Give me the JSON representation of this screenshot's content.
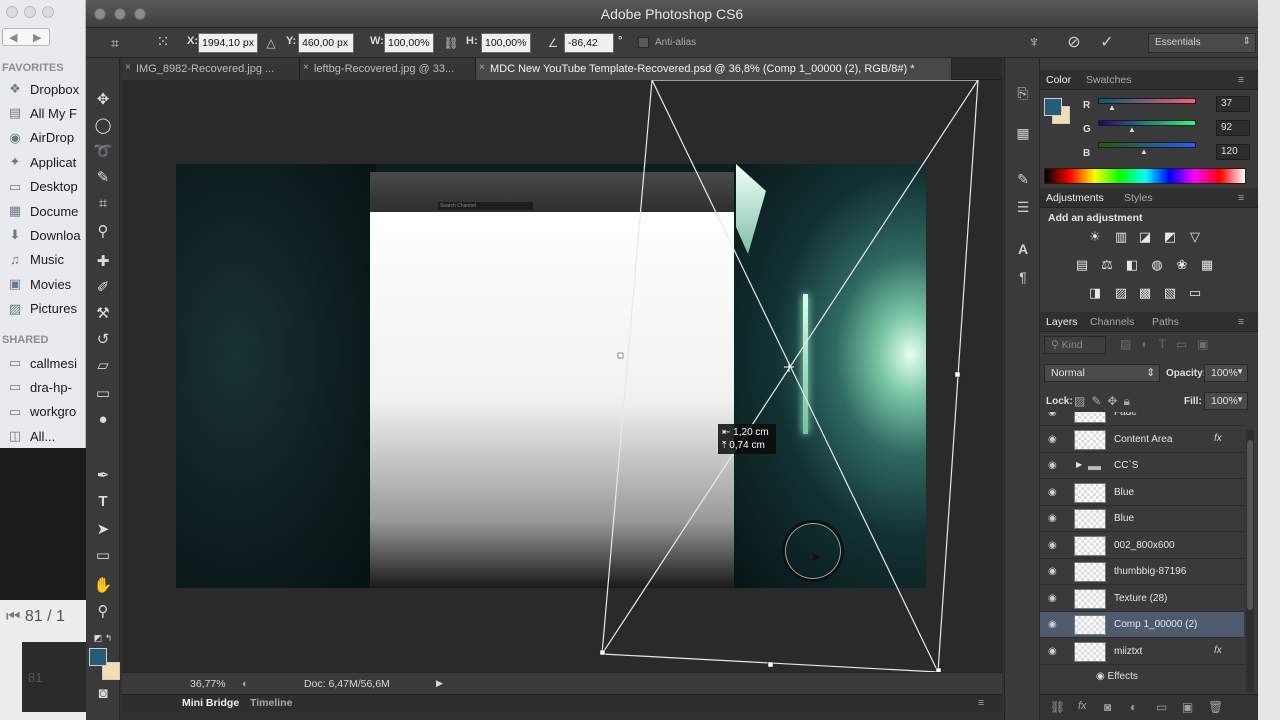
{
  "finder": {
    "favorites_header": "FAVORITES",
    "shared_header": "SHARED",
    "favorites": [
      {
        "icon": "dropbox-icon",
        "glyph": "❖",
        "label": "Dropbox"
      },
      {
        "icon": "all-my-files-icon",
        "glyph": "▤",
        "label": "All My F"
      },
      {
        "icon": "airdrop-icon",
        "glyph": "◉",
        "label": "AirDrop"
      },
      {
        "icon": "applications-icon",
        "glyph": "✦",
        "label": "Applicat"
      },
      {
        "icon": "desktop-icon",
        "glyph": "▭",
        "label": "Desktop"
      },
      {
        "icon": "documents-icon",
        "glyph": "▦",
        "label": "Docume"
      },
      {
        "icon": "downloads-icon",
        "glyph": "⬇",
        "label": "Downloa"
      },
      {
        "icon": "music-icon",
        "glyph": "♫",
        "label": "Music"
      },
      {
        "icon": "movies-icon",
        "glyph": "▣",
        "label": "Movies"
      },
      {
        "icon": "pictures-icon",
        "glyph": "▨",
        "label": "Pictures"
      }
    ],
    "shared": [
      {
        "icon": "network-computer-icon",
        "glyph": "▭",
        "label": "callmesi"
      },
      {
        "icon": "network-computer-icon",
        "glyph": "▭",
        "label": "dra-hp-"
      },
      {
        "icon": "network-computer-icon",
        "glyph": "▭",
        "label": "workgro"
      },
      {
        "icon": "network-icon",
        "glyph": "◫",
        "label": "All..."
      }
    ]
  },
  "media": {
    "page_indicator": "81 / 1",
    "thumb_label": "81"
  },
  "app": {
    "title": "Adobe Photoshop CS6"
  },
  "options": {
    "x_label": "X:",
    "x_value": "1994,10 px",
    "y_label": "Y:",
    "y_value": "460,00 px",
    "w_label": "W:",
    "w_value": "100,00%",
    "h_label": "H:",
    "h_value": "100,00%",
    "angle_value": "-86,42",
    "angle_unit": "°",
    "antialias_label": "Anti-alias",
    "workspace": "Essentials"
  },
  "tabs": [
    {
      "label": "IMG_8982-Recovered.jpg ...",
      "active": false
    },
    {
      "label": "leftbg-Recovered.jpg @ 33...",
      "active": false
    },
    {
      "label": "MDC New YouTube Template-Recovered.psd @ 36,8% (Comp 1_00000 (2), RGB/8#) *",
      "active": true
    }
  ],
  "canvas": {
    "search_placeholder": "Search Channel",
    "tooltip_line1": "1,20 cm",
    "tooltip_line2": "0,74 cm"
  },
  "status": {
    "zoom": "36,77%",
    "doc": "Doc: 6,47M/56,6M"
  },
  "bottom_tabs": {
    "mini_bridge": "Mini Bridge",
    "timeline": "Timeline"
  },
  "color_panel": {
    "tab_color": "Color",
    "tab_swatches": "Swatches",
    "r_label": "R",
    "r_value": "37",
    "g_label": "G",
    "g_value": "92",
    "b_label": "B",
    "b_value": "120",
    "foreground": "#255c78",
    "background": "#f3deb4"
  },
  "adjustments_panel": {
    "tab_adjustments": "Adjustments",
    "tab_styles": "Styles",
    "heading": "Add an adjustment"
  },
  "layers_panel": {
    "tab_layers": "Layers",
    "tab_channels": "Channels",
    "tab_paths": "Paths",
    "filter_kind": "Kind",
    "blend_mode": "Normal",
    "opacity_label": "Opacity:",
    "opacity_value": "100%",
    "lock_label": "Lock:",
    "fill_label": "Fill:",
    "fill_value": "100%",
    "layers": [
      {
        "name": "Fade",
        "fx": false,
        "selected": false
      },
      {
        "name": "Content Area",
        "fx": true,
        "selected": false
      },
      {
        "name": "CC`S",
        "fx": false,
        "selected": false,
        "group": true
      },
      {
        "name": "Blue",
        "fx": false,
        "selected": false
      },
      {
        "name": "Blue",
        "fx": false,
        "selected": false
      },
      {
        "name": "002_800x600",
        "fx": false,
        "selected": false
      },
      {
        "name": "thumbbig-87196",
        "fx": false,
        "selected": false
      },
      {
        "name": "Texture (28)",
        "fx": false,
        "selected": false
      },
      {
        "name": "Comp 1_00000 (2)",
        "fx": false,
        "selected": true
      },
      {
        "name": "miiztxt",
        "fx": true,
        "selected": false
      }
    ],
    "effects_label": "Effects",
    "fx_label": "fx"
  }
}
